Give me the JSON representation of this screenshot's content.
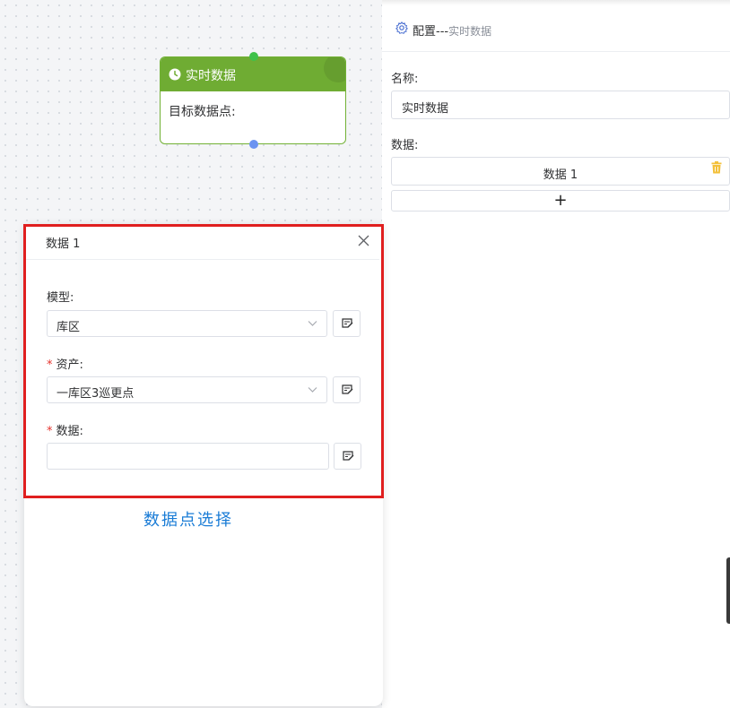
{
  "flow_node": {
    "title": "实时数据",
    "body": "目标数据点:"
  },
  "dialog": {
    "title": "数据 1",
    "model_label": "模型:",
    "model_value": "库区",
    "asset_required_mark": "*",
    "asset_label": "资产:",
    "asset_value": "一库区3巡更点",
    "data_required_mark": "*",
    "data_label": "数据:",
    "data_value": ""
  },
  "caption": "数据点选择",
  "config_panel": {
    "title": "配置---",
    "subtitle": "实时数据",
    "name_label": "名称:",
    "name_value": "实时数据",
    "data_label": "数据:",
    "data_items": [
      "数据 1"
    ],
    "add_label": "+"
  },
  "colors": {
    "node_header": "#6fac33",
    "highlight_frame": "#e01f1f",
    "caption": "#1a7cd6",
    "trash": "#f3c03a"
  }
}
